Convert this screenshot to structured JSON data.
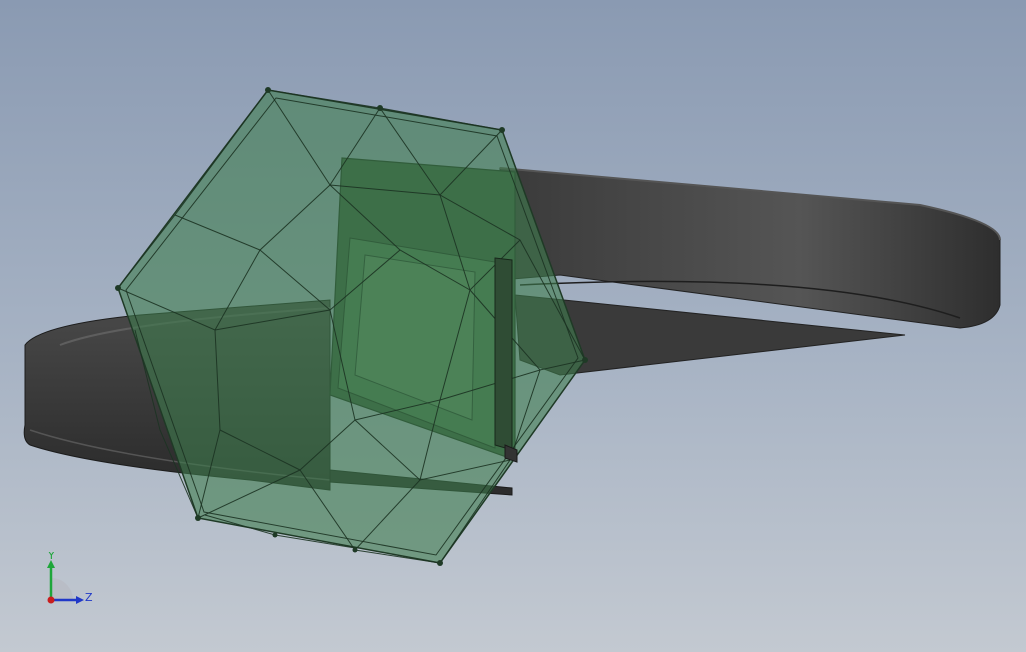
{
  "viewport": {
    "background_top": "#8a9ab2",
    "background_bottom": "#c3c9d1"
  },
  "model": {
    "band_color": "#3c3c3c",
    "band_edge_color": "#262626",
    "gem_fill": "#3f7d4f",
    "gem_edge": "#1f3a26",
    "gem_opacity": 0.6
  },
  "triad": {
    "y_label": "Y",
    "z_label": "Z",
    "y_color": "#1ea63a",
    "z_color": "#2038c8",
    "origin_color": "#c81e1e"
  }
}
